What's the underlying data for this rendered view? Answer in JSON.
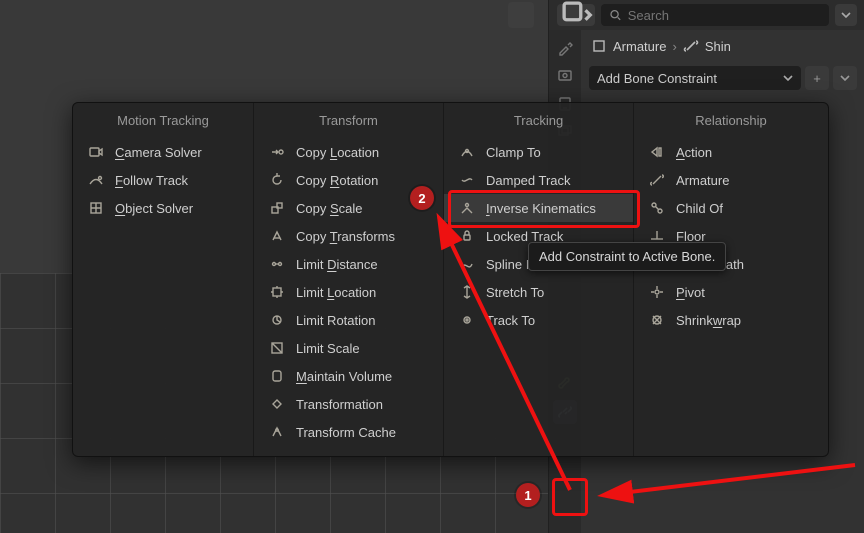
{
  "search": {
    "placeholder": "Search"
  },
  "breadcrumb": {
    "armature": "Armature",
    "bone": "Shin"
  },
  "add_dropdown": {
    "label": "Add Bone Constraint"
  },
  "tooltip": {
    "text": "Add Constraint to Active Bone."
  },
  "menu": {
    "columns": [
      {
        "header": "Motion Tracking",
        "items": [
          {
            "label": "Camera Solver",
            "u": 0,
            "icon": "camera-solver"
          },
          {
            "label": "Follow Track",
            "u": 0,
            "icon": "follow-track"
          },
          {
            "label": "Object Solver",
            "u": 0,
            "icon": "object-solver"
          }
        ]
      },
      {
        "header": "Transform",
        "items": [
          {
            "label": "Copy Location",
            "u": 5,
            "icon": "copy-location"
          },
          {
            "label": "Copy Rotation",
            "u": 5,
            "icon": "copy-rotation"
          },
          {
            "label": "Copy Scale",
            "u": 5,
            "icon": "copy-scale"
          },
          {
            "label": "Copy Transforms",
            "u": 5,
            "icon": "copy-transforms"
          },
          {
            "label": "Limit Distance",
            "u": 6,
            "icon": "limit-distance"
          },
          {
            "label": "Limit Location",
            "u": 6,
            "icon": "limit-location"
          },
          {
            "label": "Limit Rotation",
            "u": -1,
            "icon": "limit-rotation"
          },
          {
            "label": "Limit Scale",
            "u": -1,
            "icon": "limit-scale"
          },
          {
            "label": "Maintain Volume",
            "u": 0,
            "icon": "maintain-volume"
          },
          {
            "label": "Transformation",
            "u": -1,
            "icon": "transformation"
          },
          {
            "label": "Transform Cache",
            "u": -1,
            "icon": "transform-cache"
          }
        ]
      },
      {
        "header": "Tracking",
        "items": [
          {
            "label": "Clamp To",
            "u": -1,
            "icon": "clamp-to"
          },
          {
            "label": "Damped Track",
            "u": -1,
            "icon": "damped-track"
          },
          {
            "label": "Inverse Kinematics",
            "u": 0,
            "icon": "ik",
            "highlight": true
          },
          {
            "label": "Locked Track",
            "u": -1,
            "icon": "locked-track"
          },
          {
            "label": "Spline IK",
            "u": -1,
            "icon": "spline-ik"
          },
          {
            "label": "Stretch To",
            "u": -1,
            "icon": "stretch-to"
          },
          {
            "label": "Track To",
            "u": -1,
            "icon": "track-to"
          }
        ]
      },
      {
        "header": "Relationship",
        "items": [
          {
            "label": "Action",
            "u": 0,
            "icon": "action"
          },
          {
            "label": "Armature",
            "u": -1,
            "icon": "armature"
          },
          {
            "label": "Child Of",
            "u": -1,
            "icon": "child-of"
          },
          {
            "label": "Floor",
            "u": -1,
            "icon": "floor"
          },
          {
            "label": "Follow Path",
            "u": -1,
            "icon": "follow-path"
          },
          {
            "label": "Pivot",
            "u": 0,
            "icon": "pivot"
          },
          {
            "label": "Shrinkwrap",
            "u": 6,
            "icon": "shrinkwrap"
          }
        ]
      }
    ]
  },
  "annotations": {
    "step1": "1",
    "step2": "2"
  }
}
